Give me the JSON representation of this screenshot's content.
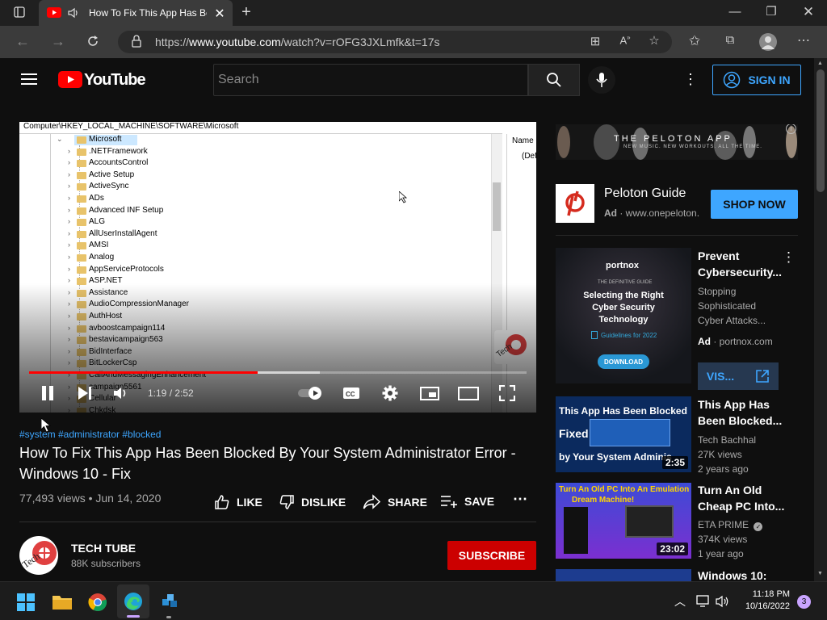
{
  "browser": {
    "tab_title": "How To Fix This App Has Be",
    "url_prefix": "https://",
    "url_host": "www.youtube.com",
    "url_rest": "/watch?v=rOFG3JXLmfk&t=17s"
  },
  "header": {
    "logo_text": "YouTube",
    "search_placeholder": "Search",
    "signin_label": "SIGN IN"
  },
  "player": {
    "reg_path": "Computer\\HKEY_LOCAL_MACHINE\\SOFTWARE\\Microsoft",
    "tree_items": [
      "Microsoft",
      ".NETFramework",
      "AccountsControl",
      "Active Setup",
      "ActiveSync",
      "ADs",
      "Advanced INF Setup",
      "ALG",
      "AllUserInstallAgent",
      "AMSI",
      "Analog",
      "AppServiceProtocols",
      "ASP.NET",
      "Assistance",
      "AudioCompressionManager",
      "AuthHost",
      "avboostcampaign114",
      "bestavicampaign563",
      "BidInterface",
      "BitLockerCsp",
      "CallAndMessagingEnhancement",
      "campaign5561",
      "Cellular",
      "Chkdsk"
    ],
    "pane_header": "Name",
    "pane_default": "(Def",
    "time_display": "1:19 / 2:52",
    "progress_fraction": 0.459,
    "buffered_fraction": 0.584
  },
  "video": {
    "tags": "#system #administrator #blocked",
    "title": "How To Fix This App Has Been Blocked By Your System Administrator Error - Windows 10 - Fix",
    "views_date": "77,493 views • Jun 14, 2020",
    "like_label": "LIKE",
    "dislike_label": "DISLIKE",
    "share_label": "SHARE",
    "save_label": "SAVE"
  },
  "channel": {
    "name": "TECH TUBE",
    "subscribers": "88K subscribers",
    "subscribe_label": "SUBSCRIBE"
  },
  "sidebar": {
    "banner_text": "THE PELOTON APP",
    "banner_sub": "NEW MUSIC. NEW WORKOUTS. ALL THE TIME.",
    "peloton": {
      "title": "Peloton Guide",
      "ad_label": "Ad",
      "url": "www.onepeloton.",
      "shop_label": "SHOP NOW"
    },
    "ad_video": {
      "title": "Prevent Cybersecurity...",
      "desc": "Stopping Sophisticated Cyber Attacks...",
      "ad_label": "Ad",
      "url": "portnox.com",
      "visit_label": "VIS...",
      "thumb_brand": "portnox",
      "thumb_kicker": "THE DEFINITIVE GUIDE",
      "thumb_heading": "Selecting the Right Cyber Security Technology",
      "thumb_sub": "Guidelines for 2022",
      "thumb_button": "DOWNLOAD"
    },
    "recommended": [
      {
        "title": "This App Has Been Blocked...",
        "channel": "Tech Bachhal",
        "views": "27K views",
        "age": "2 years ago",
        "duration": "2:35",
        "thumb_line1": "This App Has Been Blocked",
        "thumb_line2": "Fixed",
        "thumb_line3": "by Your System Adminis"
      },
      {
        "title": "Turn An Old Cheap PC Into...",
        "channel": "ETA PRIME",
        "views": "374K views",
        "age": "1 year ago",
        "duration": "23:02",
        "thumb_line1": "Turn An Old PC Into An Emulation",
        "thumb_line2": "Dream Machine!"
      },
      {
        "title": "Windows 10:"
      }
    ]
  },
  "taskbar": {
    "time": "11:18 PM",
    "date": "10/16/2022",
    "notification_count": "3"
  }
}
